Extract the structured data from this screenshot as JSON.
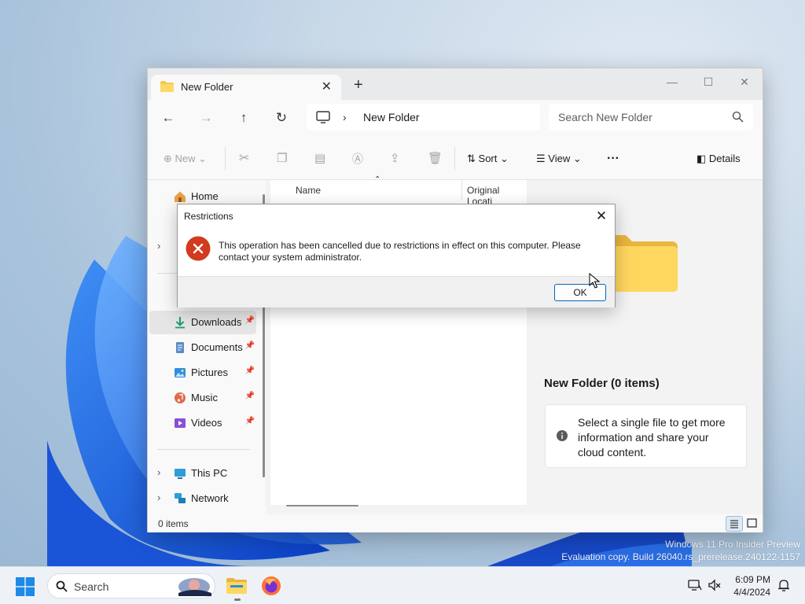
{
  "explorer": {
    "tab_title": "New Folder",
    "tab_close": "✕",
    "new_tab": "+",
    "breadcrumb": "New Folder",
    "search_placeholder": "Search New Folder",
    "commands": {
      "new": "New",
      "sort": "Sort",
      "view": "View",
      "more": "···",
      "details": "Details"
    },
    "sidebar": {
      "home": "Home",
      "downloads": "Downloads",
      "documents": "Documents",
      "pictures": "Pictures",
      "music": "Music",
      "videos": "Videos",
      "this_pc": "This PC",
      "network": "Network"
    },
    "columns": {
      "name": "Name",
      "original_location": "Original Locati"
    },
    "details_pane": {
      "title": "New Folder (0 items)",
      "info": "Select a single file to get more information and share your cloud content."
    },
    "status": "0 items"
  },
  "dialog": {
    "title": "Restrictions",
    "message": "This operation has been cancelled due to restrictions in effect on this computer. Please contact your system administrator.",
    "ok": "OK",
    "close": "✕"
  },
  "watermark": {
    "line1": "Windows 11 Pro Insider Preview",
    "line2": "Evaluation copy. Build 26040.rs_prerelease.240122-1157"
  },
  "taskbar": {
    "search": "Search",
    "time": "6:09 PM",
    "date": "4/4/2024"
  },
  "colors": {
    "accent": "#0067c0",
    "error": "#d13b1f",
    "folder": "#f5c84c"
  }
}
